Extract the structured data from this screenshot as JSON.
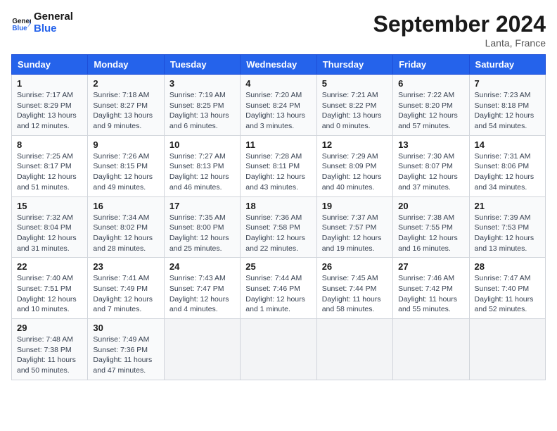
{
  "header": {
    "logo_general": "General",
    "logo_blue": "Blue",
    "month_title": "September 2024",
    "location": "Lanta, France"
  },
  "calendar": {
    "days_of_week": [
      "Sunday",
      "Monday",
      "Tuesday",
      "Wednesday",
      "Thursday",
      "Friday",
      "Saturday"
    ],
    "weeks": [
      [
        {
          "day": "",
          "info": ""
        },
        {
          "day": "2",
          "info": "Sunrise: 7:18 AM\nSunset: 8:27 PM\nDaylight: 13 hours and 9 minutes."
        },
        {
          "day": "3",
          "info": "Sunrise: 7:19 AM\nSunset: 8:25 PM\nDaylight: 13 hours and 6 minutes."
        },
        {
          "day": "4",
          "info": "Sunrise: 7:20 AM\nSunset: 8:24 PM\nDaylight: 13 hours and 3 minutes."
        },
        {
          "day": "5",
          "info": "Sunrise: 7:21 AM\nSunset: 8:22 PM\nDaylight: 13 hours and 0 minutes."
        },
        {
          "day": "6",
          "info": "Sunrise: 7:22 AM\nSunset: 8:20 PM\nDaylight: 12 hours and 57 minutes."
        },
        {
          "day": "7",
          "info": "Sunrise: 7:23 AM\nSunset: 8:18 PM\nDaylight: 12 hours and 54 minutes."
        }
      ],
      [
        {
          "day": "1",
          "info": "Sunrise: 7:17 AM\nSunset: 8:29 PM\nDaylight: 13 hours and 12 minutes."
        },
        {
          "day": "",
          "info": ""
        },
        {
          "day": "",
          "info": ""
        },
        {
          "day": "",
          "info": ""
        },
        {
          "day": "",
          "info": ""
        },
        {
          "day": "",
          "info": ""
        },
        {
          "day": "",
          "info": ""
        }
      ],
      [
        {
          "day": "8",
          "info": "Sunrise: 7:25 AM\nSunset: 8:17 PM\nDaylight: 12 hours and 51 minutes."
        },
        {
          "day": "9",
          "info": "Sunrise: 7:26 AM\nSunset: 8:15 PM\nDaylight: 12 hours and 49 minutes."
        },
        {
          "day": "10",
          "info": "Sunrise: 7:27 AM\nSunset: 8:13 PM\nDaylight: 12 hours and 46 minutes."
        },
        {
          "day": "11",
          "info": "Sunrise: 7:28 AM\nSunset: 8:11 PM\nDaylight: 12 hours and 43 minutes."
        },
        {
          "day": "12",
          "info": "Sunrise: 7:29 AM\nSunset: 8:09 PM\nDaylight: 12 hours and 40 minutes."
        },
        {
          "day": "13",
          "info": "Sunrise: 7:30 AM\nSunset: 8:07 PM\nDaylight: 12 hours and 37 minutes."
        },
        {
          "day": "14",
          "info": "Sunrise: 7:31 AM\nSunset: 8:06 PM\nDaylight: 12 hours and 34 minutes."
        }
      ],
      [
        {
          "day": "15",
          "info": "Sunrise: 7:32 AM\nSunset: 8:04 PM\nDaylight: 12 hours and 31 minutes."
        },
        {
          "day": "16",
          "info": "Sunrise: 7:34 AM\nSunset: 8:02 PM\nDaylight: 12 hours and 28 minutes."
        },
        {
          "day": "17",
          "info": "Sunrise: 7:35 AM\nSunset: 8:00 PM\nDaylight: 12 hours and 25 minutes."
        },
        {
          "day": "18",
          "info": "Sunrise: 7:36 AM\nSunset: 7:58 PM\nDaylight: 12 hours and 22 minutes."
        },
        {
          "day": "19",
          "info": "Sunrise: 7:37 AM\nSunset: 7:57 PM\nDaylight: 12 hours and 19 minutes."
        },
        {
          "day": "20",
          "info": "Sunrise: 7:38 AM\nSunset: 7:55 PM\nDaylight: 12 hours and 16 minutes."
        },
        {
          "day": "21",
          "info": "Sunrise: 7:39 AM\nSunset: 7:53 PM\nDaylight: 12 hours and 13 minutes."
        }
      ],
      [
        {
          "day": "22",
          "info": "Sunrise: 7:40 AM\nSunset: 7:51 PM\nDaylight: 12 hours and 10 minutes."
        },
        {
          "day": "23",
          "info": "Sunrise: 7:41 AM\nSunset: 7:49 PM\nDaylight: 12 hours and 7 minutes."
        },
        {
          "day": "24",
          "info": "Sunrise: 7:43 AM\nSunset: 7:47 PM\nDaylight: 12 hours and 4 minutes."
        },
        {
          "day": "25",
          "info": "Sunrise: 7:44 AM\nSunset: 7:46 PM\nDaylight: 12 hours and 1 minute."
        },
        {
          "day": "26",
          "info": "Sunrise: 7:45 AM\nSunset: 7:44 PM\nDaylight: 11 hours and 58 minutes."
        },
        {
          "day": "27",
          "info": "Sunrise: 7:46 AM\nSunset: 7:42 PM\nDaylight: 11 hours and 55 minutes."
        },
        {
          "day": "28",
          "info": "Sunrise: 7:47 AM\nSunset: 7:40 PM\nDaylight: 11 hours and 52 minutes."
        }
      ],
      [
        {
          "day": "29",
          "info": "Sunrise: 7:48 AM\nSunset: 7:38 PM\nDaylight: 11 hours and 50 minutes."
        },
        {
          "day": "30",
          "info": "Sunrise: 7:49 AM\nSunset: 7:36 PM\nDaylight: 11 hours and 47 minutes."
        },
        {
          "day": "",
          "info": ""
        },
        {
          "day": "",
          "info": ""
        },
        {
          "day": "",
          "info": ""
        },
        {
          "day": "",
          "info": ""
        },
        {
          "day": "",
          "info": ""
        }
      ]
    ]
  }
}
